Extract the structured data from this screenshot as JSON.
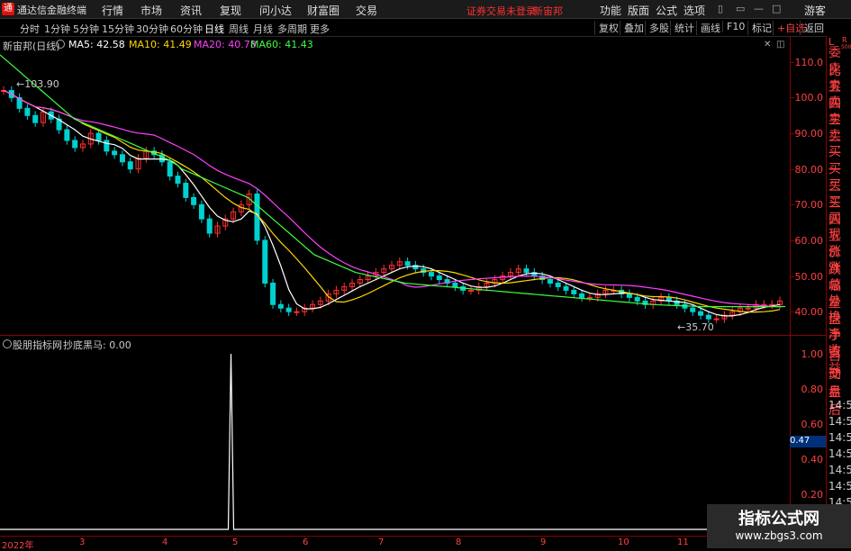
{
  "app": {
    "title": "通达信金融终端",
    "logo_glyph": "通"
  },
  "menu": [
    "行情",
    "市场",
    "资讯",
    "复现",
    "问小达",
    "财富圈",
    "交易"
  ],
  "warning": "证券交易未登录",
  "stock_name_top": "新宙邦",
  "right_menu": [
    "功能",
    "版面",
    "公式",
    "选项"
  ],
  "guest": "游客",
  "win_controls": [
    "▭",
    "—",
    "□",
    "✕"
  ],
  "periods": [
    "分时",
    "1分钟",
    "5分钟",
    "15分钟",
    "30分钟",
    "60分钟",
    "日线",
    "周线",
    "月线",
    "多周期",
    "更多"
  ],
  "active_period": "日线",
  "tool_buttons": [
    "复权",
    "叠加",
    "多股",
    "统计",
    "画线",
    "F10",
    "标记",
    "+自选",
    "返回"
  ],
  "main_chart": {
    "title": "新宙邦(日线)",
    "ma": [
      {
        "label": "MA5: 42.58",
        "color": "#ffffff"
      },
      {
        "label": "MA10: 41.49",
        "color": "#ffd700"
      },
      {
        "label": "MA20: 40.78",
        "color": "#ff40ff"
      },
      {
        "label": "MA60: 41.43",
        "color": "#40ff40"
      }
    ],
    "high_label": "103.90",
    "low_label": "35.70",
    "y_ticks": [
      "110.0",
      "100.0",
      "90.00",
      "80.00",
      "70.00",
      "60.00",
      "50.00",
      "40.00"
    ]
  },
  "sub_chart": {
    "title": "股朋指标网",
    "indicator": "抄底黑马: 0.00",
    "y_ticks": [
      "1.00",
      "0.80",
      "0.60",
      "0.40",
      "0.20"
    ],
    "current_value": "0.47"
  },
  "x_labels": [
    "2022年",
    "3",
    "4",
    "5",
    "6",
    "7",
    "8",
    "9",
    "10",
    "11"
  ],
  "right_panel": {
    "top": "L",
    "top2": "R",
    "top3": "500",
    "items": [
      "委比",
      "卖五",
      "卖四",
      "卖三",
      "卖二",
      "卖一",
      "买一",
      "买二",
      "买三",
      "买四",
      "买五",
      "现价",
      "涨跌",
      "涨幅",
      "总量",
      "外盘",
      "换手",
      "净资",
      "收益"
    ],
    "lower_items": [
      "自动",
      "交易",
      "盘后"
    ],
    "times": [
      "14:5",
      "14:5",
      "14:5",
      "14:5",
      "14:5",
      "14:5",
      "14:5",
      "14:5",
      "14:5"
    ]
  },
  "watermark": {
    "title": "指标公式网",
    "url": "www.zbgs3.com"
  },
  "chart_data": {
    "type": "line",
    "description_free": true,
    "ylim": [
      35,
      115
    ],
    "price_close": [
      102,
      100,
      97,
      95,
      93,
      96,
      94,
      91,
      88,
      86,
      87,
      90,
      88,
      85,
      84,
      82,
      80,
      83,
      85,
      84,
      82,
      78,
      76,
      72,
      70,
      66,
      62,
      64,
      66,
      68,
      70,
      73,
      60,
      48,
      42,
      41,
      40,
      40,
      41,
      42,
      43,
      45,
      46,
      47,
      48,
      49,
      50,
      51,
      52,
      53,
      54,
      53,
      52,
      51,
      50,
      49,
      48,
      47,
      46,
      46,
      47,
      48,
      49,
      50,
      51,
      52,
      51,
      50,
      49,
      48,
      47,
      46,
      45,
      44,
      44,
      45,
      46,
      46,
      45,
      44,
      43,
      42,
      43,
      44,
      43,
      42,
      41,
      40,
      39,
      38,
      38,
      39,
      40,
      41,
      41,
      42,
      42,
      42,
      43
    ],
    "ma60": [
      112,
      110,
      108,
      106,
      104,
      102,
      100,
      98,
      96,
      94,
      93,
      92,
      91,
      90,
      89,
      88,
      87,
      86,
      85,
      84,
      83,
      82,
      80,
      79,
      78,
      77,
      76,
      75,
      74,
      73,
      72,
      70,
      68,
      66,
      64,
      62,
      60,
      58,
      56,
      55,
      54,
      53,
      52,
      51,
      50.5,
      50,
      49.5,
      49,
      48.5,
      48,
      47.8,
      47.6,
      47.4,
      47.2,
      47,
      46.8,
      46.6,
      46.4,
      46.2,
      46,
      45.8,
      45.6,
      45.4,
      45.2,
      45,
      44.8,
      44.6,
      44.4,
      44.2,
      44,
      43.8,
      43.6,
      43.4,
      43.2,
      43,
      42.8,
      42.6,
      42.4,
      42.2,
      42,
      41.9,
      41.8,
      41.7,
      41.6,
      41.5,
      41.4,
      41.4,
      41.4,
      41.4,
      41.4,
      41.4,
      41.4,
      41.4,
      41.4,
      41.4,
      41.43
    ],
    "indicator_values": [
      0,
      0,
      0,
      0,
      0,
      0,
      0,
      0,
      0,
      0,
      0,
      0,
      0,
      0,
      0,
      0,
      0,
      0,
      0,
      0,
      0,
      0,
      0,
      0,
      0,
      0,
      0,
      0,
      0,
      1,
      0,
      0,
      0,
      0,
      0,
      0,
      0,
      0,
      0,
      0,
      0,
      0,
      0,
      0,
      0,
      0,
      0,
      0,
      0,
      0,
      0,
      0,
      0,
      0,
      0,
      0,
      0,
      0,
      0,
      0,
      0,
      0,
      0,
      0,
      0,
      0,
      0,
      0,
      0,
      0,
      0,
      0,
      0,
      0,
      0,
      0,
      0,
      0,
      0,
      0,
      0,
      0,
      0,
      0,
      0,
      0,
      0,
      0,
      0,
      0,
      0,
      0,
      0,
      0,
      0,
      0,
      0,
      0,
      0,
      0
    ]
  }
}
